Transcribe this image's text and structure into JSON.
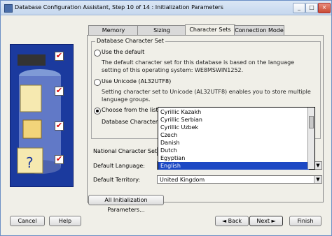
{
  "window": {
    "title": "Database Configuration Assistant, Step 10 of 14 : Initialization Parameters",
    "minimize": "_",
    "maximize": "□",
    "close": "×"
  },
  "tabs": [
    {
      "label": "Memory"
    },
    {
      "label": "Sizing"
    },
    {
      "label": "Character Sets"
    },
    {
      "label": "Connection Mode"
    }
  ],
  "charset_group": {
    "title": "Database Character Set",
    "opt_default": "Use the default",
    "opt_default_desc": "The default character set for this database is based on the language setting of this operating system: WE8MSWIN1252.",
    "opt_unicode": "Use Unicode (AL32UTF8)",
    "opt_unicode_desc": "Setting character set to Unicode (AL32UTF8) enables you to store multiple language groups.",
    "opt_choose": "Choose from the list of c",
    "db_charset_label": "Database Character Se"
  },
  "dropdown": {
    "items": [
      "Cyrillic Kazakh",
      "Cyrillic Serbian",
      "Cyrillic Uzbek",
      "Czech",
      "Danish",
      "Dutch",
      "Egyptian",
      "English"
    ],
    "selected": "English"
  },
  "fields": {
    "national_label": "National Character Set:",
    "language_label": "Default Language:",
    "territory_label": "Default Territory:",
    "territory_value": "United Kingdom"
  },
  "buttons": {
    "all_params": "All Initialization Parameters...",
    "cancel": "Cancel",
    "help": "Help",
    "back": "Back",
    "next": "Next",
    "finish": "Finish"
  },
  "icons": {
    "back_arrow": "◄",
    "next_arrow": "►",
    "check": "✔",
    "combo_arrow": "▼",
    "scroll_up": "▲"
  },
  "colors": {
    "selection": "#1c48c4",
    "panel": "#1b3a9e",
    "check": "#d40000"
  }
}
